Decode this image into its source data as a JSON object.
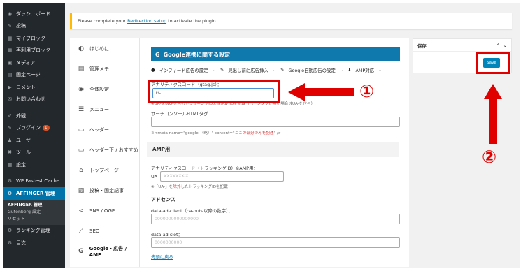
{
  "wp_sidebar": {
    "items": [
      {
        "icon": "dashboard-icon",
        "glyph": "◉",
        "label": "ダッシュボード"
      },
      {
        "icon": "pin-icon",
        "glyph": "✎",
        "label": "投稿"
      },
      {
        "icon": "blocks-icon",
        "glyph": "▦",
        "label": "マイブロック"
      },
      {
        "icon": "reusable-block-icon",
        "glyph": "▦",
        "label": "再利用ブロック"
      },
      {
        "icon": "media-icon",
        "glyph": "▣",
        "label": "メディア"
      },
      {
        "icon": "page-icon",
        "glyph": "▤",
        "label": "固定ページ"
      },
      {
        "icon": "comment-icon",
        "glyph": "▶",
        "label": "コメント"
      },
      {
        "icon": "mail-icon",
        "glyph": "✉",
        "label": "お問い合わせ"
      },
      {
        "icon": "appearance-icon",
        "glyph": "✐",
        "label": "外観"
      },
      {
        "icon": "plugin-icon",
        "glyph": "✎",
        "label": "プラグイン",
        "badge": "1"
      },
      {
        "icon": "user-icon",
        "glyph": "♟",
        "label": "ユーザー"
      },
      {
        "icon": "tool-icon",
        "glyph": "✖",
        "label": "ツール"
      },
      {
        "icon": "settings-icon",
        "glyph": "▦",
        "label": "設定"
      },
      {
        "icon": "wpfc-icon",
        "glyph": "⚙",
        "label": "WP Fastest Cache"
      },
      {
        "icon": "affinger-icon",
        "glyph": "⚙",
        "label": "AFFINGER 管理"
      }
    ],
    "submenu": [
      "AFFINGER 管理",
      "Gutenberg 設定",
      "リセット"
    ],
    "bottom": [
      {
        "icon": "ranking-icon",
        "glyph": "⚙",
        "label": "ランキング管理"
      },
      {
        "icon": "toc-icon",
        "glyph": "⚙",
        "label": "目次"
      }
    ]
  },
  "notice": {
    "prefix": "Please complete your ",
    "link": "Redirection setup",
    "suffix": " to activate the plugin."
  },
  "plugin_nav": [
    {
      "icon": "shield-icon",
      "glyph": "◐",
      "label": "はじめに"
    },
    {
      "icon": "memo-icon",
      "glyph": "▤",
      "label": "管理メモ"
    },
    {
      "icon": "palette-icon",
      "glyph": "◉",
      "label": "全体設定"
    },
    {
      "icon": "menu-icon",
      "glyph": "☰",
      "label": "メニュー"
    },
    {
      "icon": "header-icon",
      "glyph": "▭",
      "label": "ヘッダー"
    },
    {
      "icon": "header-bottom-icon",
      "glyph": "▭",
      "label": "ヘッダー下 / おすすめ"
    },
    {
      "icon": "home-icon",
      "glyph": "⌂",
      "label": "トップページ"
    },
    {
      "icon": "post-icon",
      "glyph": "▧",
      "label": "投稿・固定記事"
    },
    {
      "icon": "share-icon",
      "glyph": "<",
      "label": "SNS / OGP"
    },
    {
      "icon": "seo-icon",
      "glyph": "⟋",
      "label": "SEO"
    },
    {
      "icon": "google-icon",
      "glyph": "G",
      "label": "Google・広告 / AMP"
    }
  ],
  "main": {
    "title": "Google連携に関する設定",
    "tabs": [
      "インフィード広告の設定",
      "見出し前に広告挿入",
      "Google自動広告の設定",
      "AMP対応"
    ],
    "analytics_label": "アナリティクスコード（gtag.js）：",
    "analytics_value": "G-",
    "analytics_note": "※UA-又はG-を含むトラッキングID又は測定 IDを記載（ページタグが無い場合はUA-を付与）",
    "console_label": "サーチコンソールHTMLタグ",
    "console_note_a": "※<meta name=\"google-（略）\" content=\"",
    "console_note_em": "ここの部分のみを記述",
    "console_note_b": "\" />",
    "amp_section": "AMP用",
    "amp_analytics_label": "アナリティクスコード（トラッキングID）※AMP用：",
    "amp_prefix": "UA-",
    "amp_placeholder": "XXXXXXX-X",
    "amp_note_a": "※「UA-」を",
    "amp_note_em": "除外",
    "amp_note_b": "したトラッキングIDを記載",
    "adsense_title": "アドセンス",
    "ad_client_label": "data-ad-client（ca-pub-以降の数字）：",
    "ad_client_placeholder": "0000000000000000",
    "ad_slot_label": "data-ad-slot：",
    "ad_slot_placeholder": "0000000000",
    "back_link": "先頭に戻る"
  },
  "savebox": {
    "title": "保存",
    "button": "Save"
  },
  "annotations": {
    "one": "①",
    "two": "②"
  }
}
